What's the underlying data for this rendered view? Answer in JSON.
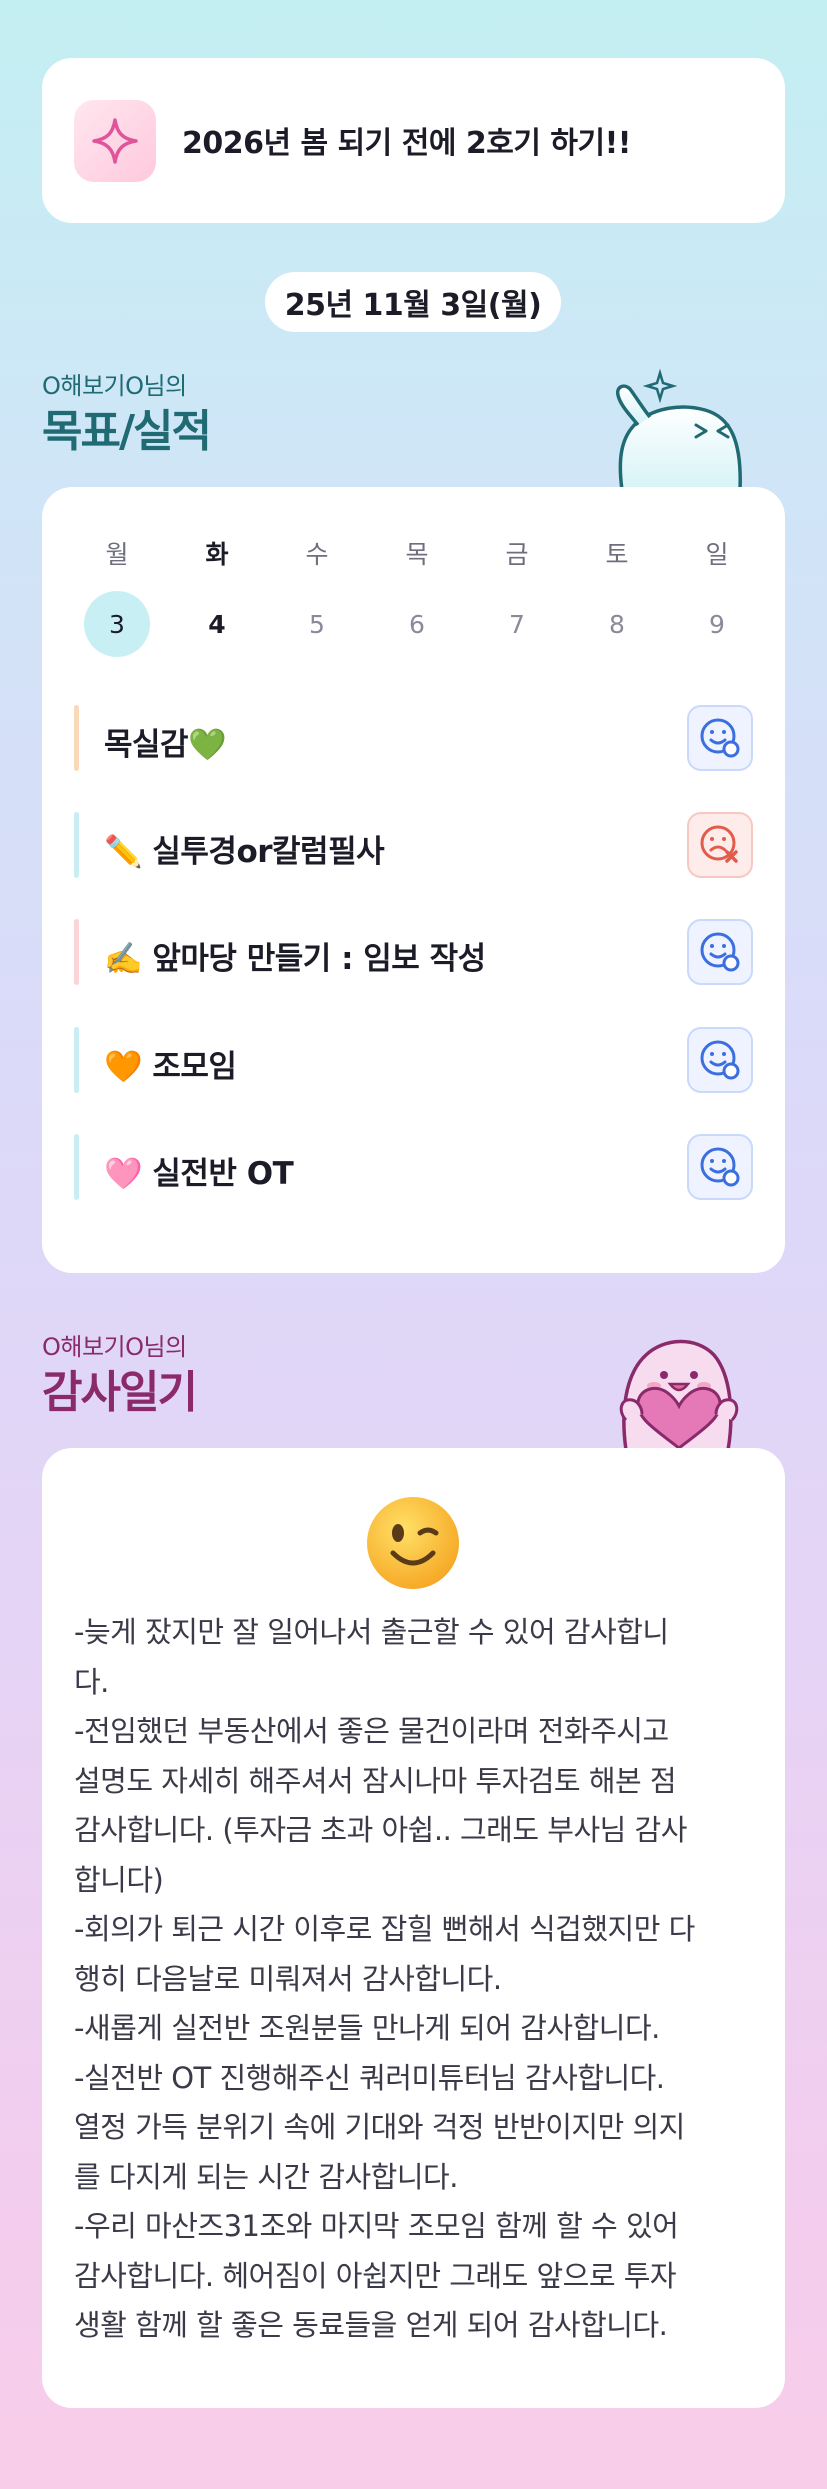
{
  "goal": {
    "text": "2026년 봄 되기 전에 2호기 하기!!",
    "icon": "sparkle-icon"
  },
  "date": "25년 11월 3일(월)",
  "plan_section": {
    "owner": "O해보기O님의",
    "title": "목표/실적"
  },
  "week": {
    "days": [
      "월",
      "화",
      "수",
      "목",
      "금",
      "토",
      "일"
    ],
    "dates": [
      "3",
      "4",
      "5",
      "6",
      "7",
      "8",
      "9"
    ],
    "today_index": 0
  },
  "tasks": [
    {
      "label": "목실감💚",
      "bar_color": "#fbd9b8",
      "status": "done"
    },
    {
      "label": "✏️ 실투경or칼럼필사",
      "bar_color": "#c8eef3",
      "status": "failed"
    },
    {
      "label": "✍️ 앞마당 만들기 : 임보 작성",
      "bar_color": "#fbd3d8",
      "status": "done"
    },
    {
      "label": "🧡 조모임",
      "bar_color": "#c8eef3",
      "status": "done"
    },
    {
      "label": "🩷 실전반 OT",
      "bar_color": "#c8eef3",
      "status": "done"
    }
  ],
  "diary_section": {
    "owner": "O해보기O님의",
    "title": "감사일기"
  },
  "diary": {
    "mood_icon": "wink-emoji-icon",
    "lines": [
      "-늦게 잤지만 잘 일어나서 출근할 수 있어 감사합니",
      "다.",
      "-전임했던 부동산에서 좋은 물건이라며 전화주시고",
      "설명도 자세히 해주셔서 잠시나마 투자검토 해본 점",
      "감사합니다. (투자금 초과 아쉽.. 그래도 부사님 감사",
      "합니다)",
      "-회의가 퇴근 시간 이후로 잡힐 뻔해서 식겁했지만 다",
      "행히 다음날로 미뤄져서 감사합니다.",
      "-새롭게 실전반 조원분들 만나게 되어 감사합니다.",
      "-실전반 OT 진행해주신 쿼러미튜터님 감사합니다.",
      "열정 가득 분위기 속에 기대와 걱정 반반이지만 의지",
      "를 다지게 되는 시간 감사합니다.",
      "-우리 마산즈31조와 마지막 조모임 함께 할 수 있어",
      "감사합니다. 헤어짐이 아쉽지만 그래도 앞으로 투자",
      "생활 함께 할 좋은 동료들을 얻게 되어 감사합니다."
    ]
  },
  "colors": {
    "plan_accent": "#1f6a73",
    "diary_accent": "#8a2a6a",
    "today_circle": "#c7eff4",
    "status_ok": "#3b6fe0",
    "status_fail": "#e35b4b"
  }
}
